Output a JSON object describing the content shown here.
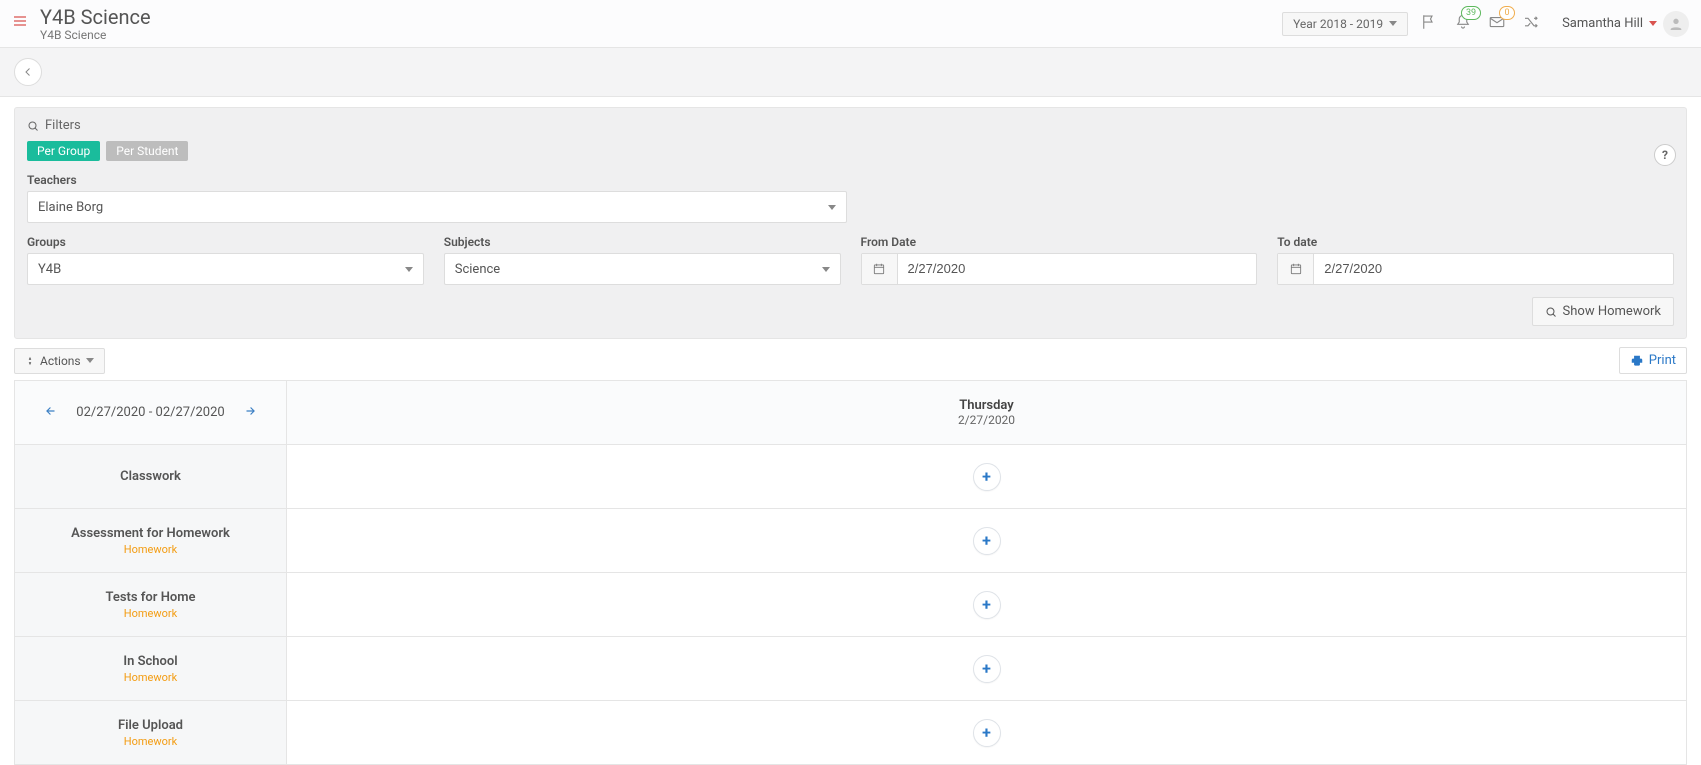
{
  "header": {
    "title": "Y4B Science",
    "subtitle": "Y4B Science",
    "year_label": "Year 2018 - 2019",
    "bell_badge": "39",
    "envelope_badge": "0",
    "user_name": "Samantha Hill"
  },
  "filters": {
    "title": "Filters",
    "tabs": {
      "per_group": "Per Group",
      "per_student": "Per Student"
    },
    "teachers": {
      "label": "Teachers",
      "value": "Elaine Borg"
    },
    "groups": {
      "label": "Groups",
      "value": "Y4B"
    },
    "subjects": {
      "label": "Subjects",
      "value": "Science"
    },
    "from_date": {
      "label": "From Date",
      "value": "2/27/2020"
    },
    "to_date": {
      "label": "To date",
      "value": "2/27/2020"
    },
    "show_homework": "Show Homework",
    "help": "?"
  },
  "actions": {
    "actions_label": "Actions",
    "print_label": "Print"
  },
  "schedule": {
    "date_range": "02/27/2020 - 02/27/2020",
    "day_name": "Thursday",
    "day_date": "2/27/2020",
    "homework_tag": "Homework",
    "rows": [
      {
        "title": "Classwork",
        "sub": ""
      },
      {
        "title": "Assessment for Homework",
        "sub": "Homework"
      },
      {
        "title": "Tests for Home",
        "sub": "Homework"
      },
      {
        "title": "In School",
        "sub": "Homework"
      },
      {
        "title": "File Upload",
        "sub": "Homework"
      }
    ]
  }
}
